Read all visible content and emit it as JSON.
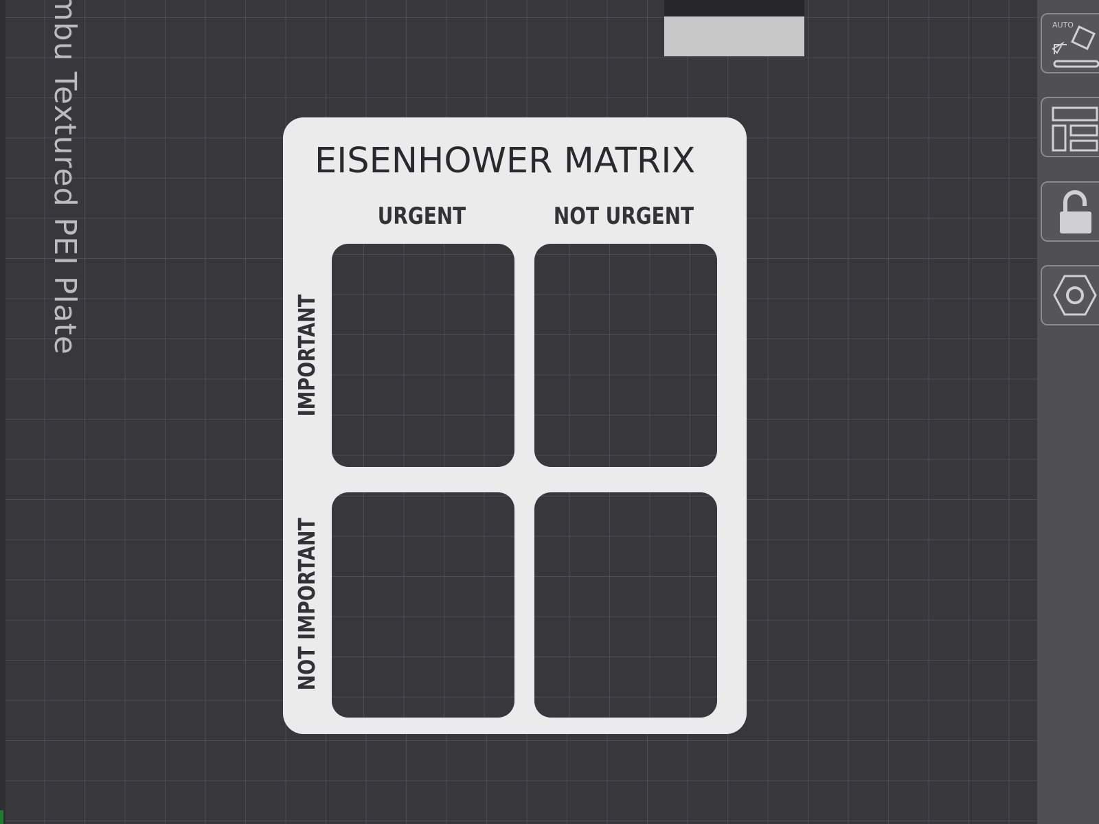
{
  "viewport": {
    "plate_label": "ambu Textured PEI Plate"
  },
  "model": {
    "title": "EISENHOWER MATRIX",
    "columns": [
      "URGENT",
      "NOT URGENT"
    ],
    "rows": [
      "IMPORTANT",
      "NOT IMPORTANT"
    ]
  },
  "toolbar": {
    "auto_orient_label": "AUTO",
    "buttons": [
      {
        "icon": "auto-orient-icon"
      },
      {
        "icon": "arrange-icon"
      },
      {
        "icon": "unlock-icon"
      },
      {
        "icon": "settings-hexagon-icon"
      }
    ]
  },
  "colors": {
    "background": "#37373c",
    "grid": "#78787f",
    "model": "#ebebeb",
    "toolbar": "#4f4f53"
  }
}
